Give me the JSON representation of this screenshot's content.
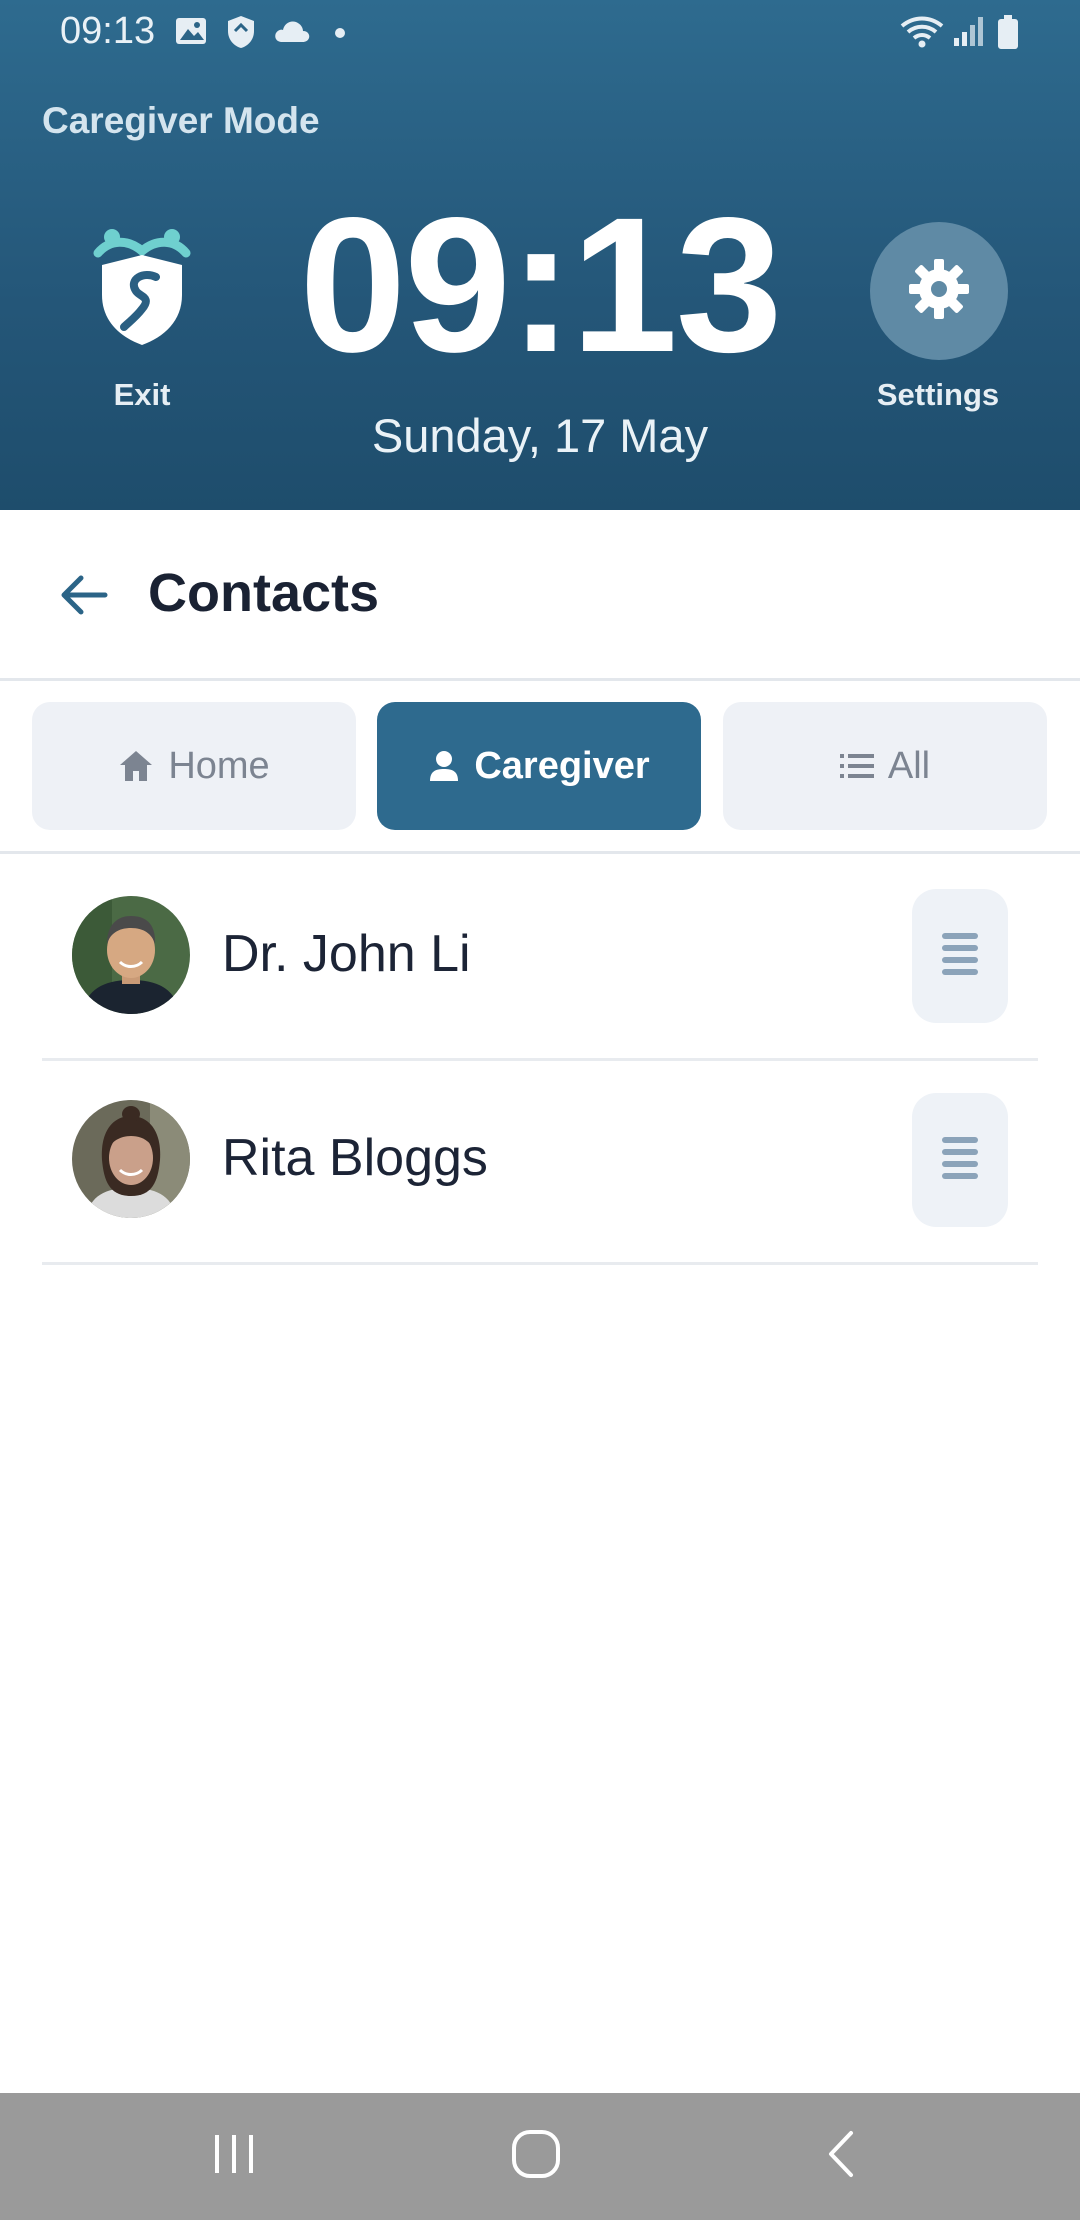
{
  "status_bar": {
    "time": "09:13",
    "left_icons": [
      "gallery-icon",
      "shield-icon",
      "cloud-icon",
      "dot-icon"
    ],
    "right_icons": [
      "wifi-icon",
      "signal-icon",
      "battery-icon"
    ]
  },
  "header": {
    "mode": "Caregiver Mode",
    "exit_label": "Exit",
    "clock": "09:13",
    "date": "Sunday, 17 May",
    "settings_label": "Settings"
  },
  "page": {
    "title": "Contacts"
  },
  "tabs": [
    {
      "label": "Home",
      "icon": "home-icon",
      "active": false
    },
    {
      "label": "Caregiver",
      "icon": "person-icon",
      "active": true
    },
    {
      "label": "All",
      "icon": "list-icon",
      "active": false
    }
  ],
  "contacts": [
    {
      "name": "Dr. John Li"
    },
    {
      "name": "Rita Bloggs"
    }
  ],
  "colors": {
    "header": "#245678",
    "accent": "#2e6a8e",
    "tab_inactive": "#eef1f6",
    "navbar": "#9a9a9a"
  }
}
